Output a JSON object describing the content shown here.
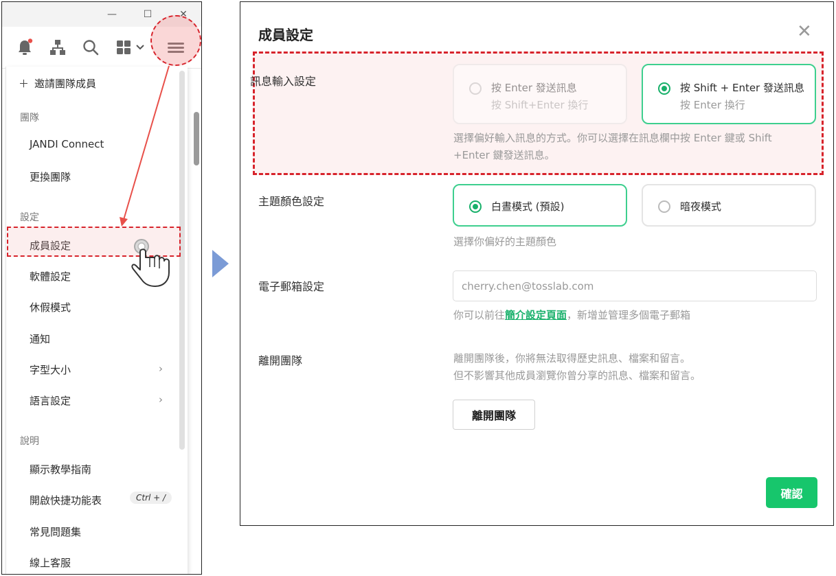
{
  "window": {
    "minimize_glyph": "—",
    "maximize_glyph": "☐",
    "close_glyph": "✕"
  },
  "toolbar": {
    "icons": [
      "bell-icon",
      "org-chart-icon",
      "search-icon",
      "apps-grid-icon",
      "chevron-down-icon",
      "hamburger-menu-icon"
    ],
    "notification_dot_color": "#e8504a"
  },
  "menu": {
    "invite": {
      "icon": "＋",
      "label": "邀請團隊成員"
    },
    "sections": {
      "team": "團隊",
      "settings": "設定",
      "help": "說明"
    },
    "team_items": [
      "JANDI Connect",
      "更換團隊"
    ],
    "settings_items": [
      "成員設定",
      "軟體設定",
      "休假模式",
      "通知",
      "字型大小",
      "語言設定"
    ],
    "help_items": [
      "顯示教學指南",
      "開啟快捷功能表",
      "常見問題集",
      "線上客服"
    ],
    "shortcut": "Ctrl + /",
    "chevron": "›"
  },
  "dialog": {
    "title": "成員設定",
    "close_glyph": "✕",
    "message_input": {
      "label": "訊息輸入設定",
      "option_enter": {
        "title": "按 Enter 發送訊息",
        "sub": "按 Shift+Enter 換行"
      },
      "option_shift": {
        "title": "按 Shift + Enter 發送訊息",
        "sub": "按 Enter 換行"
      },
      "hint_line1": "選擇偏好輸入訊息的方式。你可以選擇在訊息欄中按 Enter 鍵或 Shift",
      "hint_line2": "+Enter 鍵發送訊息。"
    },
    "theme": {
      "label": "主題顏色設定",
      "option_day": "白晝模式 (預設)",
      "option_night": "暗夜模式",
      "hint": "選擇你偏好的主題顏色"
    },
    "email": {
      "label": "電子郵箱設定",
      "placeholder": "cherry.chen@tosslab.com",
      "hint_before": "你可以前往",
      "hint_link": "簡介設定頁面",
      "hint_after": "，新增並管理多個電子郵箱"
    },
    "leave": {
      "label": "離開團隊",
      "hint_line1": "離開團隊後，你將無法取得歷史訊息、檔案和留言。",
      "hint_line2": "但不影響其他成員瀏覽你曾分享的訊息、檔案和留言。",
      "button": "離開團隊"
    },
    "confirm": "確認"
  },
  "colors": {
    "accent_green": "#17c66c",
    "highlight_red": "#d7232b",
    "arrow_blue": "#7b9bd6"
  }
}
